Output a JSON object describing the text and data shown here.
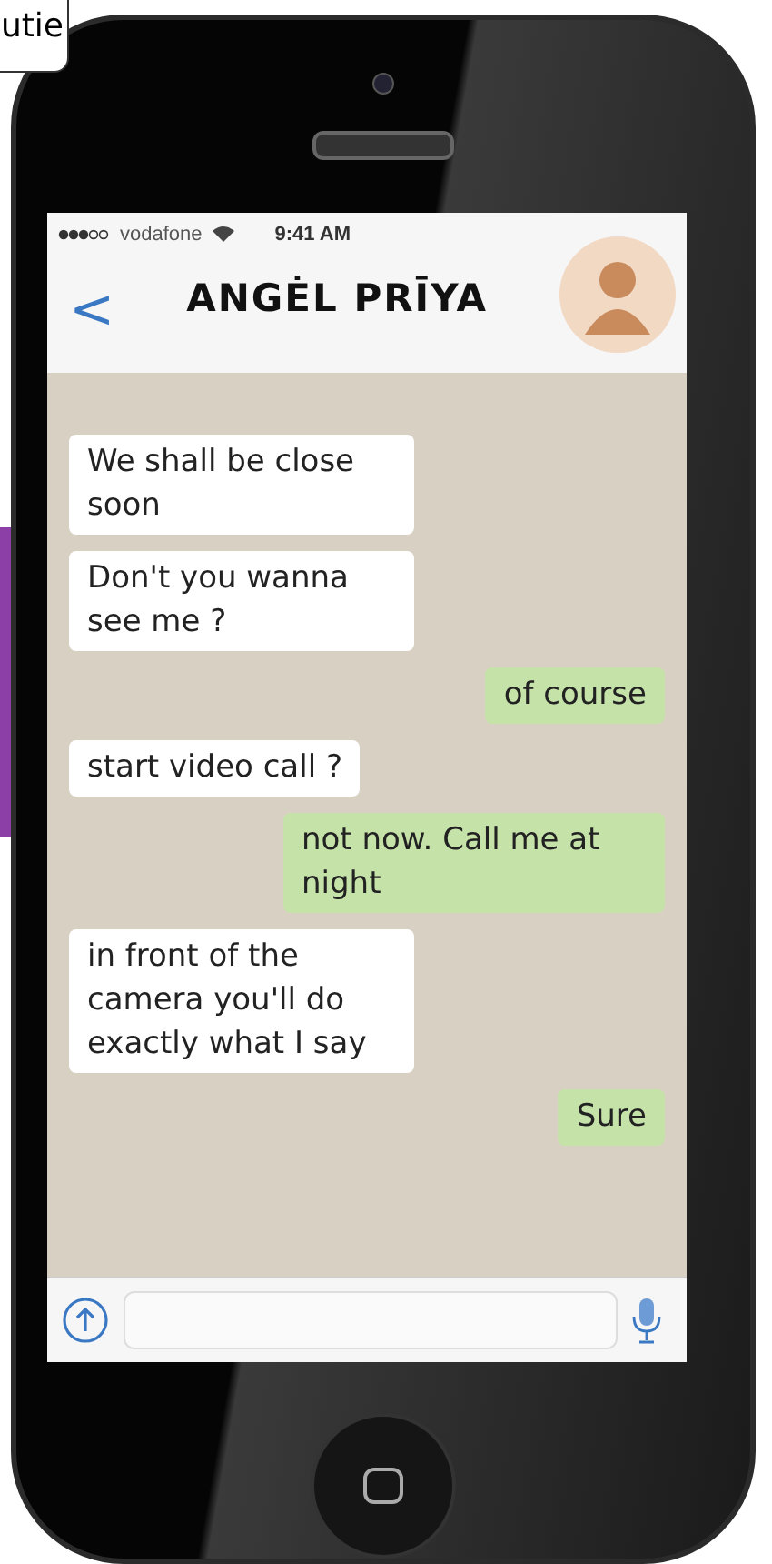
{
  "caption": {
    "text": "utie"
  },
  "status_bar": {
    "carrier": "vodafone",
    "time": "9:41 AM"
  },
  "header": {
    "back": "<",
    "title": "ANGĖL PRĪYA"
  },
  "messages": [
    {
      "kind": "incoming",
      "text": "We shall be close soon"
    },
    {
      "kind": "incoming",
      "text": "Don't you wanna see me ?"
    },
    {
      "kind": "outgoing",
      "text": "of course"
    },
    {
      "kind": "incoming",
      "text": "start video call ?"
    },
    {
      "kind": "outgoing",
      "text": "not now. Call me at night"
    },
    {
      "kind": "incoming",
      "text": "in front of the camera you'll do exactly what I say"
    },
    {
      "kind": "outgoing",
      "text": "Sure"
    }
  ]
}
